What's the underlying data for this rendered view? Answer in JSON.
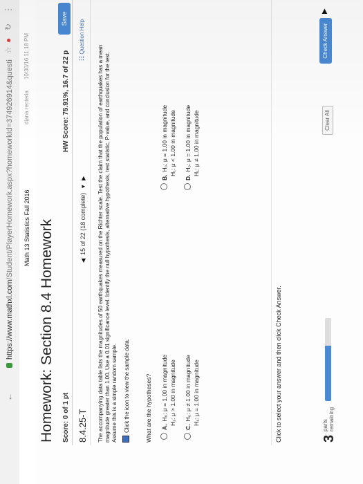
{
  "browser": {
    "url_host": "https://www.mathxl.com",
    "url_path": "/Student/PlayerHomework.aspx?homeworkId=374926914&questi"
  },
  "header": {
    "course": "Math 13 Statistics Fall 2016",
    "user": "diana renteria",
    "clock": "10/30/16 11:18 PM"
  },
  "homework": {
    "title": "Homework: Section 8.4 Homework",
    "score": "Score: 0 of 1 pt",
    "hw_score": "HW Score: 75.91%, 16.7 of 22 p",
    "save_label": "Save"
  },
  "question": {
    "number": "8.4.25-T",
    "progress": "15 of 22 (18 complete)",
    "help_label": "Question Help",
    "text_lines": [
      "The accompanying data table lists the magnitudes of 50 earthquakes measured on the Richter scale. Test the claim that the population of earthquakes has a mean",
      "magnitude greater than 1.00. Use a 0.01 significance level. Identify the null hypothesis, alternative hypothesis, test statistic, P-value, and conclusion for the test.",
      "Assume this is a simple random sample."
    ],
    "sample_link": "Click the icon to view the sample data.",
    "prompt": "What are the hypotheses?",
    "options": [
      {
        "letter": "A.",
        "h0": "H₀: μ = 1.00 in magnitude",
        "h1": "H₁: μ > 1.00 in magnitude"
      },
      {
        "letter": "B.",
        "h0": "H₀: μ = 1.00 in magnitude",
        "h1": "H₁: μ < 1.00 in magnitude"
      },
      {
        "letter": "C.",
        "h0": "H₀: μ ≠ 1.00 in magnitude",
        "h1": "H₁: μ = 1.00 in magnitude"
      },
      {
        "letter": "D.",
        "h0": "H₀: μ = 1.00 in magnitude",
        "h1": "H₁: μ ≠ 1.00 in magnitude"
      }
    ],
    "instruction": "Click to select your answer and then click Check Answer."
  },
  "footer": {
    "parts_count": "3",
    "parts_label_1": "parts",
    "parts_label_2": "remaining",
    "progress_fraction": 0.67,
    "clear_label": "Clear All",
    "check_label": "Check Answer"
  },
  "colors": {
    "accent": "#4a8ad4"
  }
}
